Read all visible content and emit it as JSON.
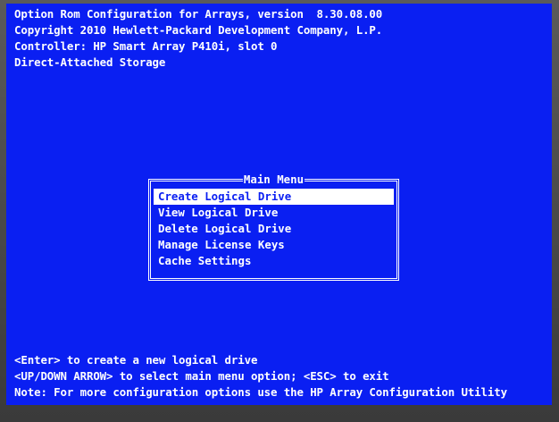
{
  "header": {
    "line1": "Option Rom Configuration for Arrays, version  8.30.08.00",
    "line2": "Copyright 2010 Hewlett-Packard Development Company, L.P.",
    "line3": "Controller: HP Smart Array P410i, slot 0",
    "line4": "Direct-Attached Storage"
  },
  "main_menu": {
    "title": "Main Menu",
    "items": [
      {
        "label": "Create Logical Drive",
        "selected": true
      },
      {
        "label": "View Logical Drive",
        "selected": false
      },
      {
        "label": "Delete Logical Drive",
        "selected": false
      },
      {
        "label": "Manage License Keys",
        "selected": false
      },
      {
        "label": "Cache Settings",
        "selected": false
      }
    ]
  },
  "footer": {
    "line1": "<Enter> to create a new logical drive",
    "line2": "<UP/DOWN ARROW> to select main menu option; <ESC> to exit",
    "line3": "Note: For more configuration options use the HP Array Configuration Utility"
  },
  "colors": {
    "screen_background": "#0a1ff2",
    "text": "#ffffff",
    "selection_background": "#ffffff",
    "selection_text": "#0a1ff2"
  }
}
